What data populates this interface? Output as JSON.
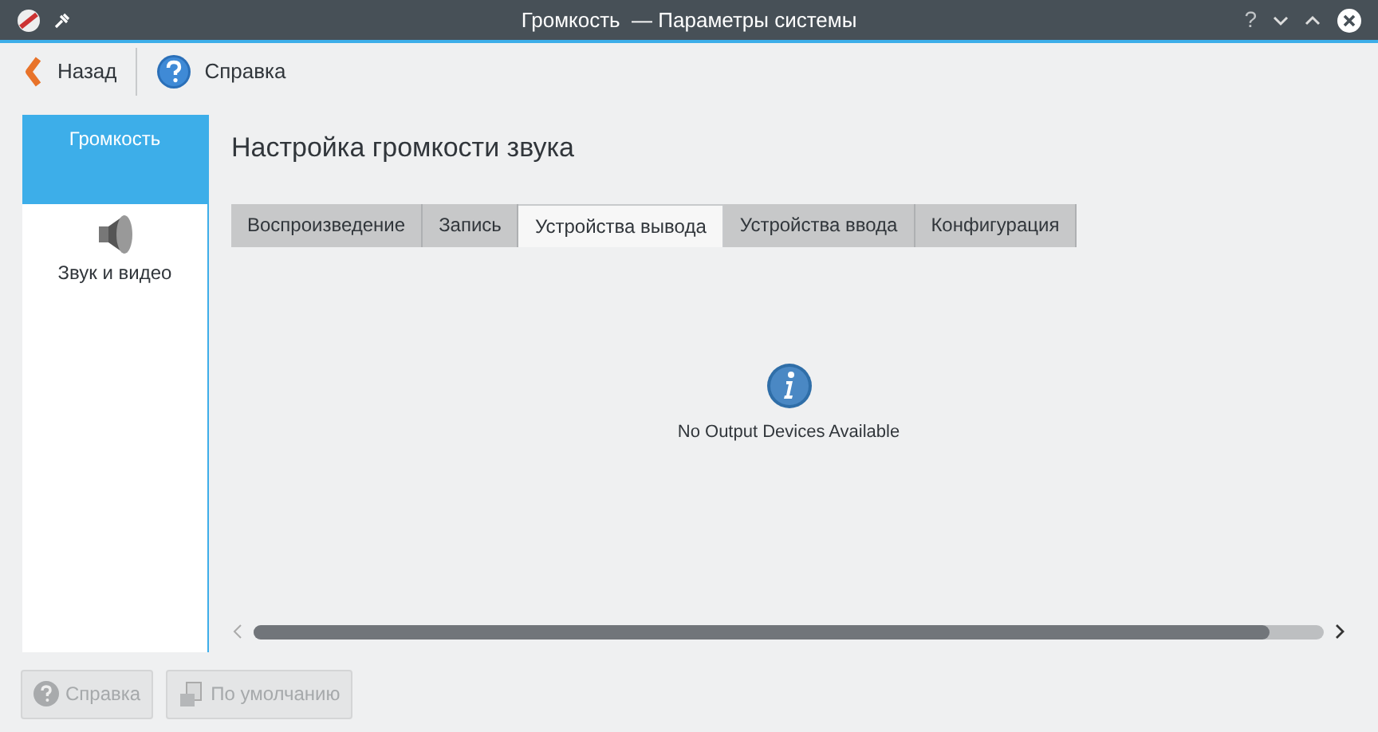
{
  "window": {
    "title": "Громкость  — Параметры системы",
    "help": "?"
  },
  "toolbar": [
    {
      "kind": "back",
      "label": "Назад"
    },
    {
      "kind": "help",
      "label": "Справка"
    }
  ],
  "sidebar": {
    "items": [
      {
        "label": "Громкость",
        "selected": true,
        "kind": "blank"
      },
      {
        "label": "Звук и видео",
        "selected": false,
        "kind": "speaker"
      }
    ]
  },
  "page": {
    "title": "Настройка громкости звука",
    "tabs": [
      {
        "label": "Воспроизведение",
        "selected": false
      },
      {
        "label": "Запись",
        "selected": false
      },
      {
        "label": "Устройства вывода",
        "selected": true
      },
      {
        "label": "Устройства ввода",
        "selected": false
      },
      {
        "label": "Конфигурация",
        "selected": false
      }
    ],
    "message": "No Output Devices Available"
  },
  "buttons": [
    {
      "kind": "help",
      "label": "Справка",
      "disabled": true
    },
    {
      "kind": "defaults",
      "label": "По умолчанию",
      "disabled": true
    }
  ]
}
